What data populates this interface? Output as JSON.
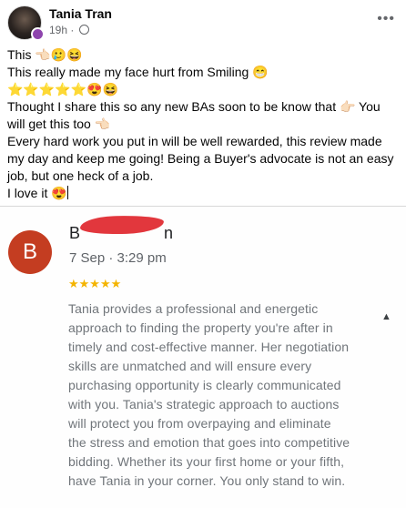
{
  "post": {
    "author": "Tania Tran",
    "time": "19h",
    "more_label": "•••",
    "lines": {
      "l1": "This 👈🏻🥲😆",
      "l2": "This really made my face hurt from Smiling 😁",
      "l3": "⭐⭐⭐⭐⭐😍😆",
      "l4": "Thought I share this so any new BAs soon to be know that 👉🏻 You will get this too 👈🏻",
      "l5": "Every hard work you put in will be well rewarded, this review made my day and keep me going! Being a Buyer's advocate is not an easy job, but one heck of a job.",
      "l6": "I love it 😍"
    }
  },
  "review_card": {
    "avatar_letter": "B",
    "reviewer_name_start": "B",
    "reviewer_name_end": "n",
    "date": "7 Sep · 3:29 pm",
    "stars": "★★★★★",
    "rating": 5,
    "text": "Tania provides a professional and energetic approach to finding the property you're after in timely and cost-effective manner. Her negotiation skills are unmatched and will ensure every purchasing opportunity is clearly communicated with you. Tania's strategic approach to auctions will protect you from overpaying and eliminate the stress and emotion that goes into competitive bidding. Whether its your first home or your fifth, have Tania in your corner. You only stand to win.",
    "collapse_icon": "▲"
  },
  "colors": {
    "avatar_red": "#c43d21",
    "star_yellow": "#f4b400",
    "redaction": "#e2373d"
  }
}
